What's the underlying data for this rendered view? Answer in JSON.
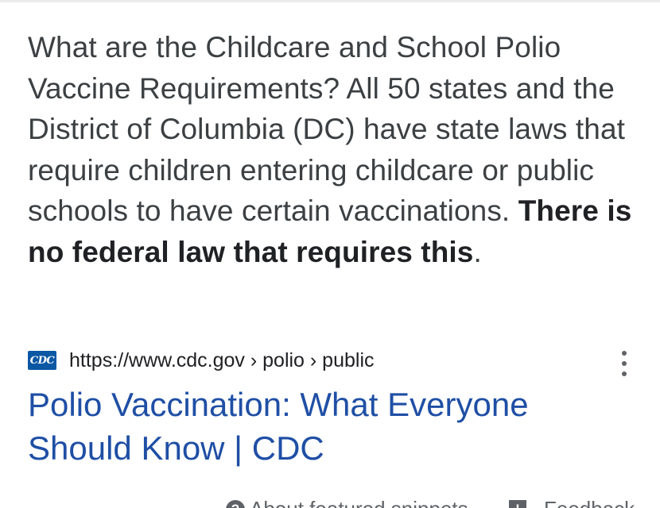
{
  "snippet": {
    "text_plain": "What are the Childcare and School Polio Vaccine Requirements? All 50 states and the District of Columbia (DC) have state laws that require children entering childcare or public schools to have certain vaccinations. ",
    "text_bold": "There is no federal law that requires this",
    "text_end": "."
  },
  "source": {
    "favicon_text": "CDC",
    "url": "https://www.cdc.gov › polio › public",
    "more_icon": "more-vert-icon"
  },
  "result": {
    "title": "Polio Vaccination: What Everyone Should Know | CDC"
  },
  "footer": {
    "about_label": "About featured snippets",
    "about_icon": "?",
    "feedback_label": "Feedback",
    "feedback_icon": "!"
  },
  "colors": {
    "link": "#1f4fa5",
    "text": "#3c4043",
    "favicon_bg": "#0a57a4"
  }
}
